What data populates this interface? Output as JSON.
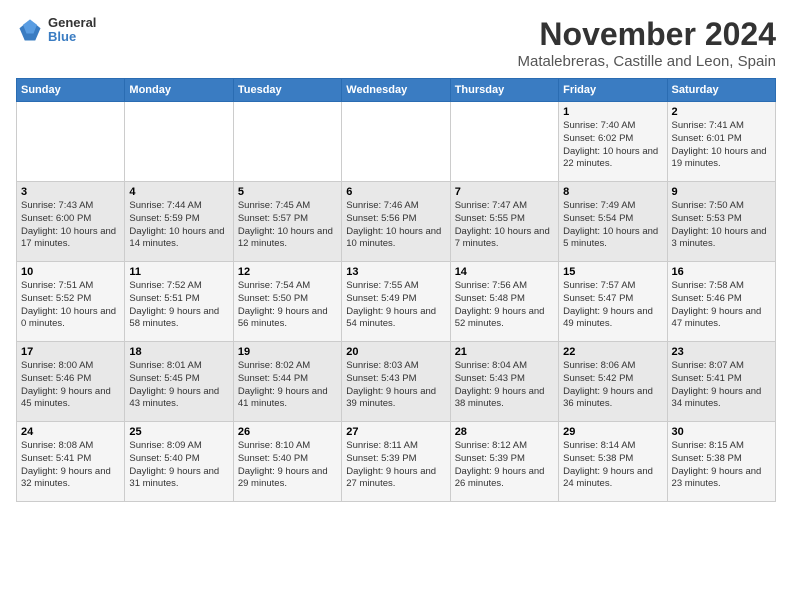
{
  "logo": {
    "general": "General",
    "blue": "Blue"
  },
  "header": {
    "month_year": "November 2024",
    "location": "Matalebreras, Castille and Leon, Spain"
  },
  "weekdays": [
    "Sunday",
    "Monday",
    "Tuesday",
    "Wednesday",
    "Thursday",
    "Friday",
    "Saturday"
  ],
  "weeks": [
    [
      {
        "day": "",
        "info": ""
      },
      {
        "day": "",
        "info": ""
      },
      {
        "day": "",
        "info": ""
      },
      {
        "day": "",
        "info": ""
      },
      {
        "day": "",
        "info": ""
      },
      {
        "day": "1",
        "info": "Sunrise: 7:40 AM\nSunset: 6:02 PM\nDaylight: 10 hours and 22 minutes."
      },
      {
        "day": "2",
        "info": "Sunrise: 7:41 AM\nSunset: 6:01 PM\nDaylight: 10 hours and 19 minutes."
      }
    ],
    [
      {
        "day": "3",
        "info": "Sunrise: 7:43 AM\nSunset: 6:00 PM\nDaylight: 10 hours and 17 minutes."
      },
      {
        "day": "4",
        "info": "Sunrise: 7:44 AM\nSunset: 5:59 PM\nDaylight: 10 hours and 14 minutes."
      },
      {
        "day": "5",
        "info": "Sunrise: 7:45 AM\nSunset: 5:57 PM\nDaylight: 10 hours and 12 minutes."
      },
      {
        "day": "6",
        "info": "Sunrise: 7:46 AM\nSunset: 5:56 PM\nDaylight: 10 hours and 10 minutes."
      },
      {
        "day": "7",
        "info": "Sunrise: 7:47 AM\nSunset: 5:55 PM\nDaylight: 10 hours and 7 minutes."
      },
      {
        "day": "8",
        "info": "Sunrise: 7:49 AM\nSunset: 5:54 PM\nDaylight: 10 hours and 5 minutes."
      },
      {
        "day": "9",
        "info": "Sunrise: 7:50 AM\nSunset: 5:53 PM\nDaylight: 10 hours and 3 minutes."
      }
    ],
    [
      {
        "day": "10",
        "info": "Sunrise: 7:51 AM\nSunset: 5:52 PM\nDaylight: 10 hours and 0 minutes."
      },
      {
        "day": "11",
        "info": "Sunrise: 7:52 AM\nSunset: 5:51 PM\nDaylight: 9 hours and 58 minutes."
      },
      {
        "day": "12",
        "info": "Sunrise: 7:54 AM\nSunset: 5:50 PM\nDaylight: 9 hours and 56 minutes."
      },
      {
        "day": "13",
        "info": "Sunrise: 7:55 AM\nSunset: 5:49 PM\nDaylight: 9 hours and 54 minutes."
      },
      {
        "day": "14",
        "info": "Sunrise: 7:56 AM\nSunset: 5:48 PM\nDaylight: 9 hours and 52 minutes."
      },
      {
        "day": "15",
        "info": "Sunrise: 7:57 AM\nSunset: 5:47 PM\nDaylight: 9 hours and 49 minutes."
      },
      {
        "day": "16",
        "info": "Sunrise: 7:58 AM\nSunset: 5:46 PM\nDaylight: 9 hours and 47 minutes."
      }
    ],
    [
      {
        "day": "17",
        "info": "Sunrise: 8:00 AM\nSunset: 5:46 PM\nDaylight: 9 hours and 45 minutes."
      },
      {
        "day": "18",
        "info": "Sunrise: 8:01 AM\nSunset: 5:45 PM\nDaylight: 9 hours and 43 minutes."
      },
      {
        "day": "19",
        "info": "Sunrise: 8:02 AM\nSunset: 5:44 PM\nDaylight: 9 hours and 41 minutes."
      },
      {
        "day": "20",
        "info": "Sunrise: 8:03 AM\nSunset: 5:43 PM\nDaylight: 9 hours and 39 minutes."
      },
      {
        "day": "21",
        "info": "Sunrise: 8:04 AM\nSunset: 5:43 PM\nDaylight: 9 hours and 38 minutes."
      },
      {
        "day": "22",
        "info": "Sunrise: 8:06 AM\nSunset: 5:42 PM\nDaylight: 9 hours and 36 minutes."
      },
      {
        "day": "23",
        "info": "Sunrise: 8:07 AM\nSunset: 5:41 PM\nDaylight: 9 hours and 34 minutes."
      }
    ],
    [
      {
        "day": "24",
        "info": "Sunrise: 8:08 AM\nSunset: 5:41 PM\nDaylight: 9 hours and 32 minutes."
      },
      {
        "day": "25",
        "info": "Sunrise: 8:09 AM\nSunset: 5:40 PM\nDaylight: 9 hours and 31 minutes."
      },
      {
        "day": "26",
        "info": "Sunrise: 8:10 AM\nSunset: 5:40 PM\nDaylight: 9 hours and 29 minutes."
      },
      {
        "day": "27",
        "info": "Sunrise: 8:11 AM\nSunset: 5:39 PM\nDaylight: 9 hours and 27 minutes."
      },
      {
        "day": "28",
        "info": "Sunrise: 8:12 AM\nSunset: 5:39 PM\nDaylight: 9 hours and 26 minutes."
      },
      {
        "day": "29",
        "info": "Sunrise: 8:14 AM\nSunset: 5:38 PM\nDaylight: 9 hours and 24 minutes."
      },
      {
        "day": "30",
        "info": "Sunrise: 8:15 AM\nSunset: 5:38 PM\nDaylight: 9 hours and 23 minutes."
      }
    ]
  ]
}
